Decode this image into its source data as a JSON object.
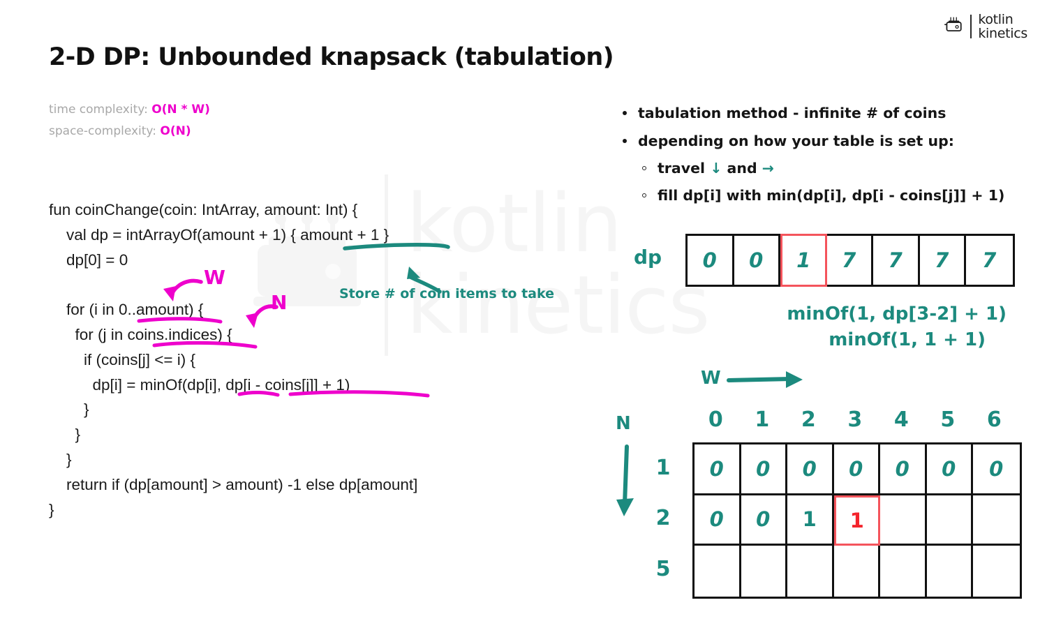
{
  "brand": {
    "icon": "toaster-icon",
    "line1": "kotlin",
    "line2": "kinetics"
  },
  "watermark": {
    "line1": "kotlin",
    "line2": "kinetics"
  },
  "title": "2-D DP: Unbounded knapsack (tabulation)",
  "complexity": {
    "time_label": "time complexity: ",
    "time_value": "O(N * W)",
    "space_label": "space-complexity: ",
    "space_value": "O(N)"
  },
  "code": "fun coinChange(coin: IntArray, amount: Int) {\n    val dp = intArrayOf(amount + 1) { amount + 1 }\n    dp[0] = 0\n\n    for (i in 0..amount) {\n      for (j in coins.indices) {\n        if (coins[j] <= i) {\n          dp[i] = minOf(dp[i], dp[i - coins[j]] + 1)\n        }\n      }\n    }\n    return if (dp[amount] > amount) -1 else dp[amount]\n}",
  "annotations": {
    "w_label": "W",
    "n_label": "N",
    "store_note": "Store # of coin items to take",
    "w_axis": "W",
    "n_axis": "N"
  },
  "bullets": [
    {
      "level": 1,
      "text": "tabulation method - infinite # of coins"
    },
    {
      "level": 1,
      "text": "depending on how your table is set up:"
    },
    {
      "level": 2,
      "text_before": "travel",
      "arrow_down": "↓",
      "text_mid": "and",
      "arrow_right": "→"
    },
    {
      "level": 2,
      "text": "fill dp[i] with min(dp[i], dp[i - coins[j]] + 1)"
    }
  ],
  "minof": {
    "line1": "minOf(1, dp[3-2] + 1)",
    "line2": "minOf(1, 1 + 1)"
  },
  "colors": {
    "teal": "#1c8a7e",
    "magenta": "#ee00cc",
    "red": "#f4545c",
    "gray": "#a8a8a8",
    "ink": "#111111"
  },
  "chart_data": {
    "type": "table",
    "dp_array": {
      "label": "dp",
      "values": [
        "0",
        "0",
        "1",
        "7",
        "7",
        "7",
        "7"
      ],
      "highlight_index": 2
    },
    "grid": {
      "col_header_label": "W",
      "row_header_label": "N",
      "columns": [
        "0",
        "1",
        "2",
        "3",
        "4",
        "5",
        "6"
      ],
      "rows": [
        "1",
        "2",
        "5"
      ],
      "cells": [
        [
          "0",
          "0",
          "0",
          "0",
          "0",
          "0",
          "0"
        ],
        [
          "0",
          "0",
          "1",
          "1",
          "",
          "",
          ""
        ],
        [
          "",
          "",
          "",
          "",
          "",
          "",
          ""
        ]
      ],
      "italic_flags": [
        [
          true,
          true,
          true,
          true,
          true,
          true,
          true
        ],
        [
          true,
          true,
          false,
          false,
          false,
          false,
          false
        ],
        [
          false,
          false,
          false,
          false,
          false,
          false,
          false
        ]
      ],
      "highlight_cell": {
        "row": 1,
        "col": 3
      }
    }
  }
}
